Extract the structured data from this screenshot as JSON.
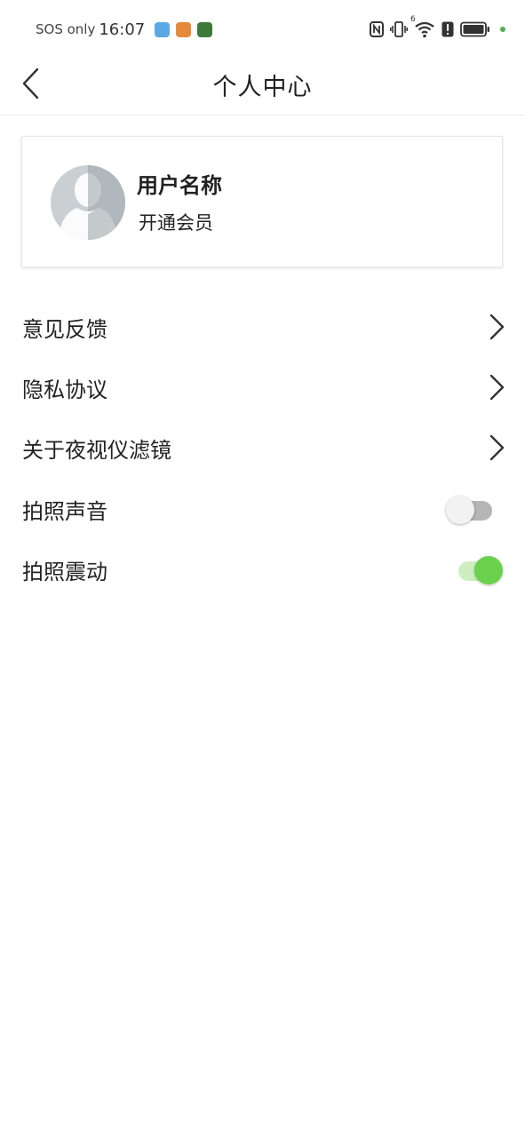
{
  "status_bar": {
    "carrier": "SOS only",
    "time": "16:07",
    "icons": [
      "nfc-icon",
      "vibrate-icon",
      "wifi-icon",
      "alert-icon",
      "battery-icon"
    ],
    "wifi_label": "6"
  },
  "header": {
    "title": "个人中心",
    "back_icon": "chevron-left-icon"
  },
  "profile": {
    "username": "用户名称",
    "membership": "开通会员",
    "avatar_icon": "default-avatar-icon"
  },
  "menu": {
    "items": [
      {
        "label": "意见反馈",
        "type": "link",
        "icon": "chevron-right-icon"
      },
      {
        "label": "隐私协议",
        "type": "link",
        "icon": "chevron-right-icon"
      },
      {
        "label": "关于夜视仪滤镜",
        "type": "link",
        "icon": "chevron-right-icon"
      },
      {
        "label": "拍照声音",
        "type": "toggle",
        "on": false
      },
      {
        "label": "拍照震动",
        "type": "toggle",
        "on": true
      }
    ]
  },
  "colors": {
    "accent_green": "#6ad14c",
    "toggle_off_track": "#b5b5b5",
    "toggle_on_track": "#cdeec0",
    "toggle_off_knob": "#f2f2f2"
  }
}
